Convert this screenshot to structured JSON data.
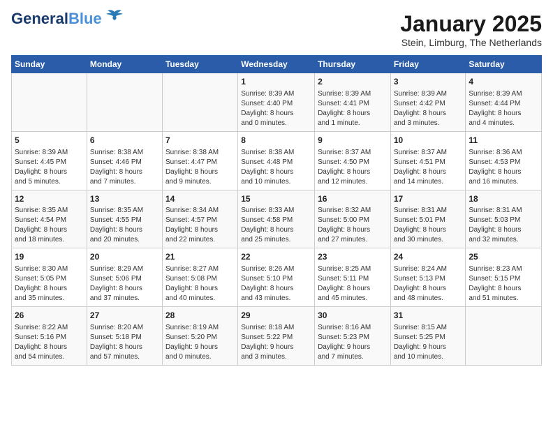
{
  "header": {
    "logo_line1": "General",
    "logo_line2": "Blue",
    "main_title": "January 2025",
    "subtitle": "Stein, Limburg, The Netherlands"
  },
  "days_of_week": [
    "Sunday",
    "Monday",
    "Tuesday",
    "Wednesday",
    "Thursday",
    "Friday",
    "Saturday"
  ],
  "weeks": [
    [
      {
        "day": "",
        "info": ""
      },
      {
        "day": "",
        "info": ""
      },
      {
        "day": "",
        "info": ""
      },
      {
        "day": "1",
        "info": "Sunrise: 8:39 AM\nSunset: 4:40 PM\nDaylight: 8 hours\nand 0 minutes."
      },
      {
        "day": "2",
        "info": "Sunrise: 8:39 AM\nSunset: 4:41 PM\nDaylight: 8 hours\nand 1 minute."
      },
      {
        "day": "3",
        "info": "Sunrise: 8:39 AM\nSunset: 4:42 PM\nDaylight: 8 hours\nand 3 minutes."
      },
      {
        "day": "4",
        "info": "Sunrise: 8:39 AM\nSunset: 4:44 PM\nDaylight: 8 hours\nand 4 minutes."
      }
    ],
    [
      {
        "day": "5",
        "info": "Sunrise: 8:39 AM\nSunset: 4:45 PM\nDaylight: 8 hours\nand 5 minutes."
      },
      {
        "day": "6",
        "info": "Sunrise: 8:38 AM\nSunset: 4:46 PM\nDaylight: 8 hours\nand 7 minutes."
      },
      {
        "day": "7",
        "info": "Sunrise: 8:38 AM\nSunset: 4:47 PM\nDaylight: 8 hours\nand 9 minutes."
      },
      {
        "day": "8",
        "info": "Sunrise: 8:38 AM\nSunset: 4:48 PM\nDaylight: 8 hours\nand 10 minutes."
      },
      {
        "day": "9",
        "info": "Sunrise: 8:37 AM\nSunset: 4:50 PM\nDaylight: 8 hours\nand 12 minutes."
      },
      {
        "day": "10",
        "info": "Sunrise: 8:37 AM\nSunset: 4:51 PM\nDaylight: 8 hours\nand 14 minutes."
      },
      {
        "day": "11",
        "info": "Sunrise: 8:36 AM\nSunset: 4:53 PM\nDaylight: 8 hours\nand 16 minutes."
      }
    ],
    [
      {
        "day": "12",
        "info": "Sunrise: 8:35 AM\nSunset: 4:54 PM\nDaylight: 8 hours\nand 18 minutes."
      },
      {
        "day": "13",
        "info": "Sunrise: 8:35 AM\nSunset: 4:55 PM\nDaylight: 8 hours\nand 20 minutes."
      },
      {
        "day": "14",
        "info": "Sunrise: 8:34 AM\nSunset: 4:57 PM\nDaylight: 8 hours\nand 22 minutes."
      },
      {
        "day": "15",
        "info": "Sunrise: 8:33 AM\nSunset: 4:58 PM\nDaylight: 8 hours\nand 25 minutes."
      },
      {
        "day": "16",
        "info": "Sunrise: 8:32 AM\nSunset: 5:00 PM\nDaylight: 8 hours\nand 27 minutes."
      },
      {
        "day": "17",
        "info": "Sunrise: 8:31 AM\nSunset: 5:01 PM\nDaylight: 8 hours\nand 30 minutes."
      },
      {
        "day": "18",
        "info": "Sunrise: 8:31 AM\nSunset: 5:03 PM\nDaylight: 8 hours\nand 32 minutes."
      }
    ],
    [
      {
        "day": "19",
        "info": "Sunrise: 8:30 AM\nSunset: 5:05 PM\nDaylight: 8 hours\nand 35 minutes."
      },
      {
        "day": "20",
        "info": "Sunrise: 8:29 AM\nSunset: 5:06 PM\nDaylight: 8 hours\nand 37 minutes."
      },
      {
        "day": "21",
        "info": "Sunrise: 8:27 AM\nSunset: 5:08 PM\nDaylight: 8 hours\nand 40 minutes."
      },
      {
        "day": "22",
        "info": "Sunrise: 8:26 AM\nSunset: 5:10 PM\nDaylight: 8 hours\nand 43 minutes."
      },
      {
        "day": "23",
        "info": "Sunrise: 8:25 AM\nSunset: 5:11 PM\nDaylight: 8 hours\nand 45 minutes."
      },
      {
        "day": "24",
        "info": "Sunrise: 8:24 AM\nSunset: 5:13 PM\nDaylight: 8 hours\nand 48 minutes."
      },
      {
        "day": "25",
        "info": "Sunrise: 8:23 AM\nSunset: 5:15 PM\nDaylight: 8 hours\nand 51 minutes."
      }
    ],
    [
      {
        "day": "26",
        "info": "Sunrise: 8:22 AM\nSunset: 5:16 PM\nDaylight: 8 hours\nand 54 minutes."
      },
      {
        "day": "27",
        "info": "Sunrise: 8:20 AM\nSunset: 5:18 PM\nDaylight: 8 hours\nand 57 minutes."
      },
      {
        "day": "28",
        "info": "Sunrise: 8:19 AM\nSunset: 5:20 PM\nDaylight: 9 hours\nand 0 minutes."
      },
      {
        "day": "29",
        "info": "Sunrise: 8:18 AM\nSunset: 5:22 PM\nDaylight: 9 hours\nand 3 minutes."
      },
      {
        "day": "30",
        "info": "Sunrise: 8:16 AM\nSunset: 5:23 PM\nDaylight: 9 hours\nand 7 minutes."
      },
      {
        "day": "31",
        "info": "Sunrise: 8:15 AM\nSunset: 5:25 PM\nDaylight: 9 hours\nand 10 minutes."
      },
      {
        "day": "",
        "info": ""
      }
    ]
  ]
}
